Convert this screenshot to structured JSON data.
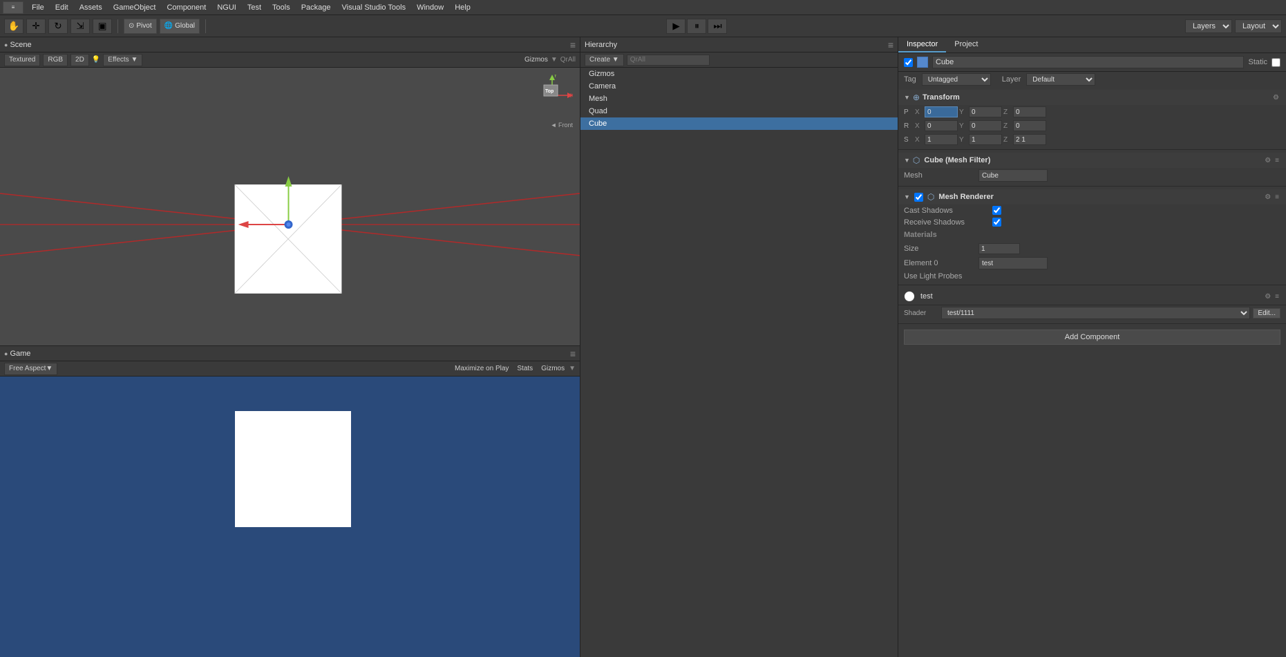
{
  "menubar": {
    "items": [
      "File",
      "Edit",
      "Assets",
      "GameObject",
      "Component",
      "NGUI",
      "Test",
      "Tools",
      "Package",
      "Visual Studio Tools",
      "Window",
      "Help"
    ]
  },
  "toolbar": {
    "pivot_label": "Pivot",
    "global_label": "Global",
    "play_icon": "▶",
    "pause_icon": "⏸",
    "step_icon": "⏭",
    "layers_label": "Layers",
    "layout_label": "Layout"
  },
  "scene": {
    "tab_label": "Scene",
    "view_mode": "Textured",
    "color_mode": "RGB",
    "dimension": "2D",
    "gizmos_label": "Gizmos",
    "all_label": "QrAll",
    "front_label": "◄ Front",
    "controls": [
      "Textured",
      "RGB",
      "2D",
      "Effects ▼"
    ]
  },
  "game": {
    "tab_label": "Game",
    "free_aspect_label": "Free Aspect",
    "maximize_label": "Maximize on Play",
    "stats_label": "Stats",
    "gizmos_label": "Gizmos"
  },
  "hierarchy": {
    "tab_label": "Hierarchy",
    "create_label": "Create ▼",
    "search_placeholder": "QrAll",
    "items": [
      {
        "name": "Gizmos",
        "selected": false
      },
      {
        "name": "Camera",
        "selected": false
      },
      {
        "name": "Mesh",
        "selected": false
      },
      {
        "name": "Quad",
        "selected": false
      },
      {
        "name": "Cube",
        "selected": true
      }
    ]
  },
  "inspector": {
    "tab_label": "Inspector",
    "project_tab_label": "Project",
    "object_name": "Cube",
    "static_label": "Static",
    "tag_label": "Tag",
    "tag_value": "Untagged",
    "layer_label": "Layer",
    "layer_value": "Default",
    "transform": {
      "title": "Transform",
      "position_label": "P",
      "rotation_label": "R",
      "scale_label": "S",
      "px": "0",
      "py": "0",
      "pz": "0",
      "rx": "0",
      "ry": "0",
      "rz": "0",
      "sx": "1",
      "sy": "1",
      "sz": "2 1"
    },
    "mesh_filter": {
      "title": "Cube (Mesh Filter)",
      "mesh_label": "Mesh",
      "mesh_value": "Cube"
    },
    "mesh_renderer": {
      "title": "Mesh Renderer",
      "cast_shadows_label": "Cast Shadows",
      "cast_shadows_checked": true,
      "receive_shadows_label": "Receive Shadows",
      "receive_shadows_checked": true,
      "materials_label": "Materials",
      "size_label": "Size",
      "size_value": "1",
      "element_label": "Element 0",
      "element_value": "test",
      "use_light_probes_label": "Use Light Probes"
    },
    "material": {
      "name": "test",
      "shader_label": "Shader",
      "shader_value": "test/1111",
      "edit_label": "Edit..."
    },
    "add_component_label": "Add Component"
  }
}
